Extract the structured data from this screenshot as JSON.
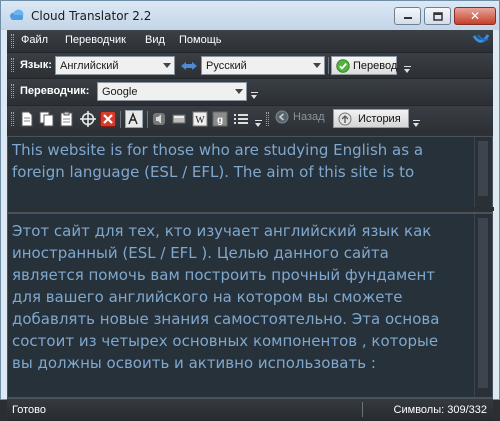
{
  "window": {
    "title": "Cloud Translator 2.2"
  },
  "menu": [
    "Файл",
    "Переводчик",
    "Вид",
    "Помощь"
  ],
  "lang_toolbar": {
    "label": "Язык:",
    "source_lang": "Английский",
    "target_lang": "Русский",
    "translate_label": "Перевод"
  },
  "translator_toolbar": {
    "label": "Переводчик:",
    "engine": "Google"
  },
  "tools_toolbar": {
    "back_label": "Назад",
    "history_label": "История"
  },
  "source_text": "This website is for those who are studying English as a foreign language (ESL / EFL). The aim of this site is to",
  "translated_text": "Этот сайт для тех, кто изучает английский язык как иностранный (ESL / EFL ). Целью данного сайта является помочь вам построить прочный фундамент для вашего английского на котором вы сможете добавлять новые знания самостоятельно. Эта основа состоит из четырех основных компонентов , которые вы должны освоить и активно использовать :",
  "status": {
    "left": "Готово",
    "right": "Символы: 309/332"
  },
  "colors": {
    "text_blue": "#7fa8cf",
    "background": "#273139"
  }
}
